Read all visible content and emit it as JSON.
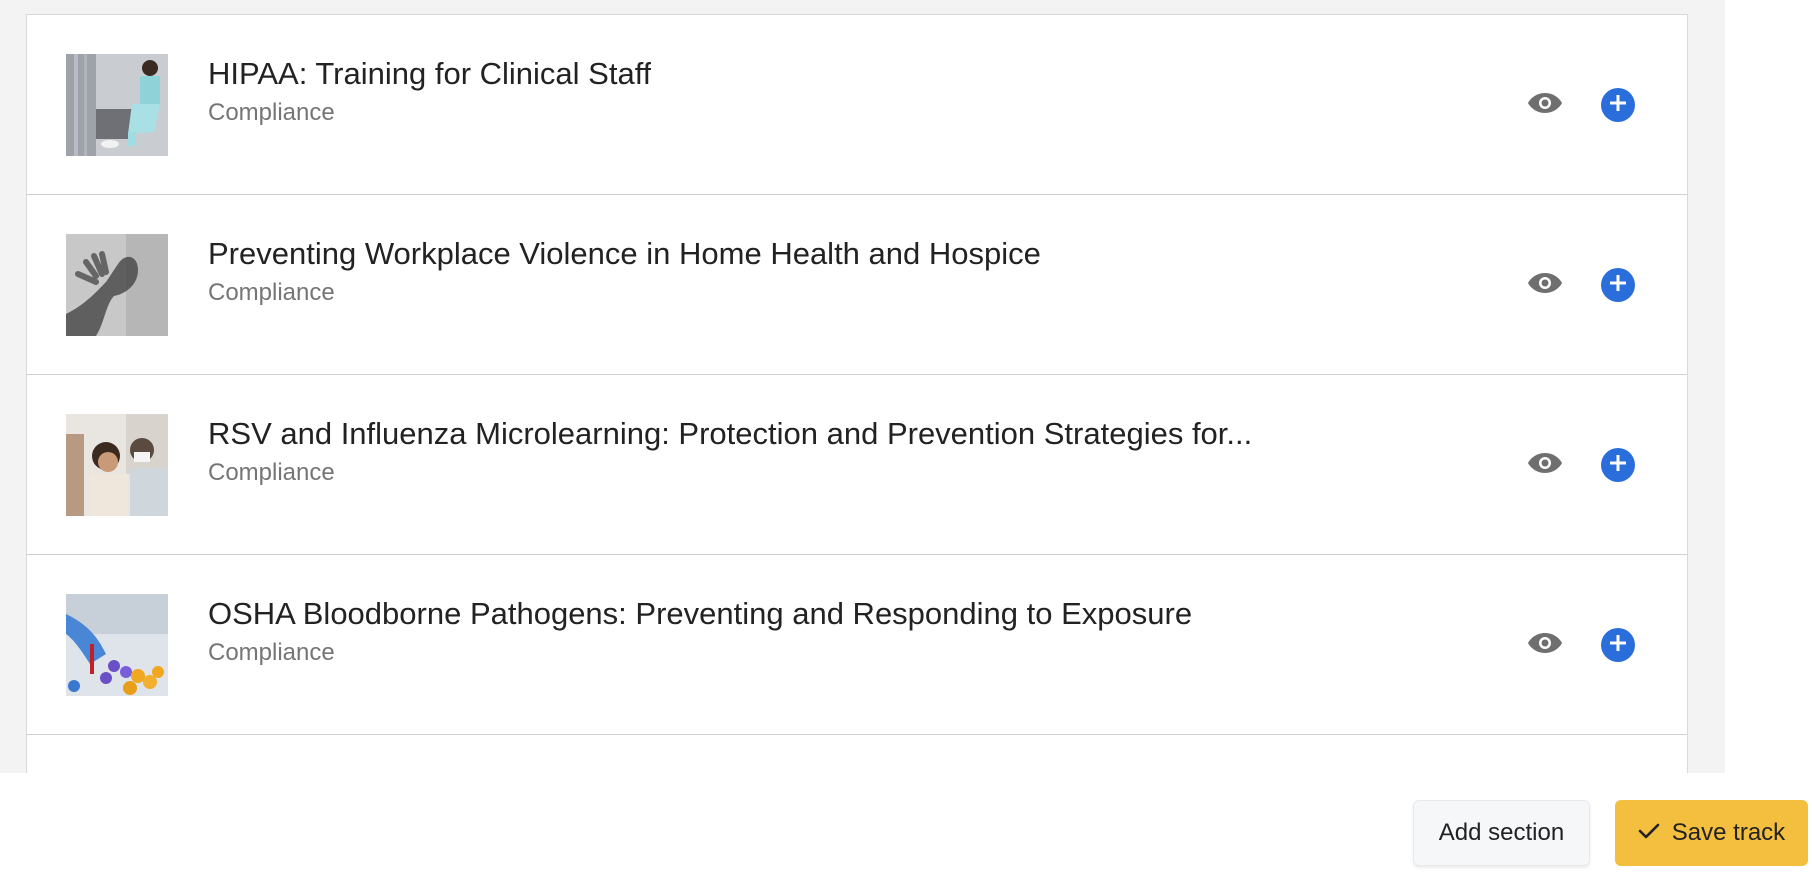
{
  "courses": [
    {
      "title": "HIPAA: Training for Clinical Staff",
      "category": "Compliance"
    },
    {
      "title": "Preventing Workplace Violence in Home Health and Hospice",
      "category": "Compliance"
    },
    {
      "title": "RSV and Influenza Microlearning: Protection and Prevention Strategies for...",
      "category": "Compliance"
    },
    {
      "title": "OSHA Bloodborne Pathogens: Preventing and Responding to Exposure",
      "category": "Compliance"
    }
  ],
  "icons": {
    "preview": "eye-icon",
    "add": "plus-circle-icon",
    "save": "check-icon"
  },
  "colors": {
    "accent_blue": "#2a6edb",
    "save_yellow": "#f4bf3f",
    "icon_grey": "#6f6f6f"
  },
  "footer": {
    "add_section_label": "Add section",
    "save_track_label": "Save track"
  }
}
